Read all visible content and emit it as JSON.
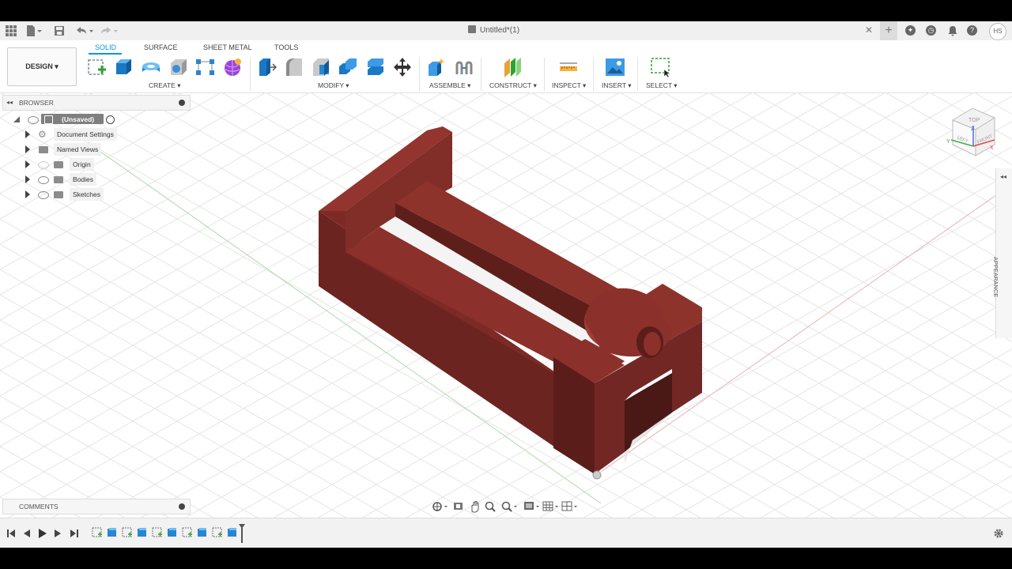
{
  "titlebar": {
    "document_title": "Untitled*(1)",
    "close_glyph": "✕",
    "new_tab_glyph": "+",
    "user_initials": "HS",
    "help_glyph": "?",
    "icons": [
      "app-grid-icon",
      "file-menu-icon",
      "save-icon",
      "undo-icon",
      "redo-icon",
      "extensions-icon",
      "job-status-icon",
      "notifications-icon",
      "help-icon"
    ]
  },
  "workspace": {
    "label": "DESIGN ▾"
  },
  "ribbon": {
    "tabs": [
      "SOLID",
      "SURFACE",
      "SHEET METAL",
      "TOOLS"
    ],
    "active_tab": "SOLID",
    "groups": [
      "CREATE ▾",
      "MODIFY ▾",
      "ASSEMBLE ▾",
      "CONSTRUCT ▾",
      "INSPECT ▾",
      "INSERT ▾",
      "SELECT ▾"
    ]
  },
  "browser": {
    "title": "BROWSER",
    "root": "(Unsaved)",
    "items": [
      "Document Settings",
      "Named Views",
      "Origin",
      "Bodies",
      "Sketches"
    ]
  },
  "appearance_panel": {
    "label": "APPEARANCE"
  },
  "comments": {
    "title": "COMMENTS"
  },
  "viewcube": {
    "faces": [
      "TOP",
      "FRONT",
      "LEFT"
    ],
    "axes": [
      "Z",
      "X",
      "Y"
    ]
  },
  "colors": {
    "accent": "#0696d7",
    "model_body": "#7d2a26",
    "model_top": "#93342e",
    "model_dark": "#5a1d1a",
    "grid": "#e4e4e4",
    "axis_red": "#e8a6a6",
    "axis_green": "#9fd89f"
  }
}
